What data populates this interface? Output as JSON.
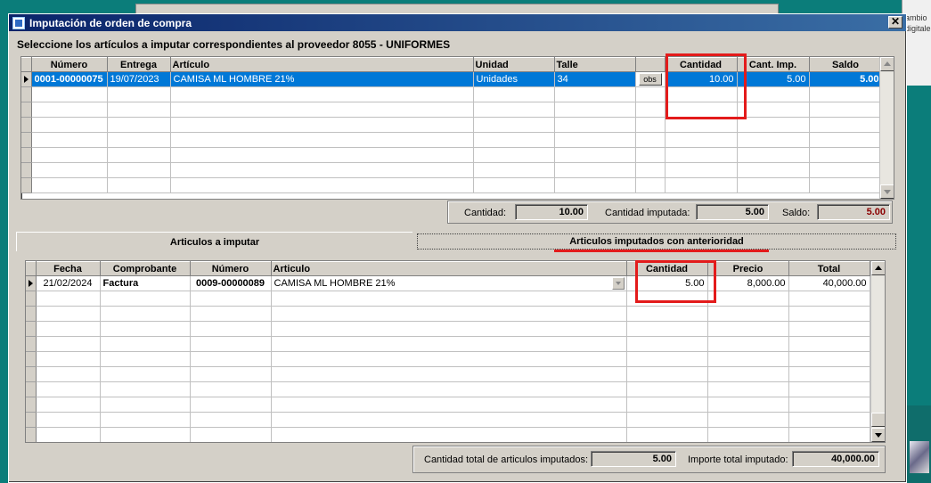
{
  "background": {
    "right_panel_lines": [
      "ambio",
      "digitale"
    ]
  },
  "window": {
    "title": "Imputación de orden de compra",
    "close_glyph": "✕",
    "subtitle": "Seleccione los artículos a imputar correspondientes al proveedor 8055 - UNIFORMES"
  },
  "articles_grid": {
    "columns": [
      "Número",
      "Entrega",
      "Artículo",
      "Unidad",
      "Talle",
      "",
      "Cantidad",
      "Cant. Imp.",
      "Saldo"
    ],
    "rows": [
      {
        "numero": "0001-00000075",
        "entrega": "19/07/2023",
        "articulo": "CAMISA ML HOMBRE 21%",
        "unidad": "Unidades",
        "talle": "34",
        "obs": "obs",
        "cantidad": "10.00",
        "cant_imp": "5.00",
        "saldo": "5.00"
      }
    ]
  },
  "summary_top": {
    "cantidad_label": "Cantidad:",
    "cantidad_value": "10.00",
    "imputada_label": "Cantidad imputada:",
    "imputada_value": "5.00",
    "saldo_label": "Saldo:",
    "saldo_value": "5.00"
  },
  "tabs": {
    "tab1": "Articulos a imputar",
    "tab2": "Articulos imputados con anterioridad"
  },
  "imputed_grid": {
    "columns": [
      "Fecha",
      "Comprobante",
      "Número",
      "Articulo",
      "Cantidad",
      "Precio",
      "Total"
    ],
    "rows": [
      {
        "fecha": "21/02/2024",
        "comprobante": "Factura",
        "numero": "0009-00000089",
        "articulo": "CAMISA ML HOMBRE 21%",
        "cantidad": "5.00",
        "precio": "8,000.00",
        "total": "40,000.00"
      }
    ]
  },
  "summary_bottom": {
    "total_label": "Cantidad total de articulos imputados:",
    "total_value": "5.00",
    "importe_label": "Importe total imputado:",
    "importe_value": "40,000.00"
  },
  "colors": {
    "highlight": "#e31b1b",
    "selection": "#0078d7",
    "saldo_text": "#8b0000",
    "title_bar": "#0a246a"
  }
}
